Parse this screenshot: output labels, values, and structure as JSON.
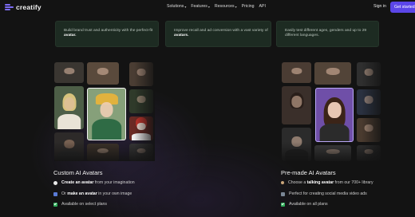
{
  "brand": {
    "name": "creatify",
    "accent": "#5b46e8"
  },
  "nav": {
    "items": [
      {
        "label": "Solutions",
        "dropdown": true
      },
      {
        "label": "Features",
        "dropdown": true
      },
      {
        "label": "Resources",
        "dropdown": true
      },
      {
        "label": "Pricing",
        "dropdown": false
      },
      {
        "label": "API",
        "dropdown": false
      }
    ],
    "signin": "Sign in",
    "cta": "Get started"
  },
  "cards": [
    {
      "pre": "Build brand trust and authenticity with the perfect-fit ",
      "bold": "avatar.",
      "post": ""
    },
    {
      "pre": "Improve recall and ad conversion with a vast variety of ",
      "bold": "avatars.",
      "post": ""
    },
    {
      "pre": "Easily test different ages, genders and up to 29 different languages.",
      "bold": "",
      "post": ""
    }
  ],
  "custom": {
    "title": "Custom AI Avatars",
    "items": [
      {
        "icon": "sparkle-icon",
        "bold": "Create an avatar",
        "text": " from your imagination",
        "pre": ""
      },
      {
        "icon": "image-icon",
        "pre": "Or ",
        "bold": "make an avatar",
        "text": " in your own image"
      },
      {
        "icon": "check-icon",
        "pre": "",
        "bold": "",
        "text": "Available on select plans"
      }
    ]
  },
  "premade": {
    "title": "Pre-made AI Avatars",
    "items": [
      {
        "icon": "people-icon",
        "pre": "Choose a ",
        "bold": "talking avatar",
        "text": " from our 700+ library"
      },
      {
        "icon": "grid-icon",
        "pre": "",
        "bold": "",
        "text": "Perfect for creating social media video ads"
      },
      {
        "icon": "check-icon",
        "pre": "",
        "bold": "",
        "text": "Available on all plans"
      }
    ]
  }
}
